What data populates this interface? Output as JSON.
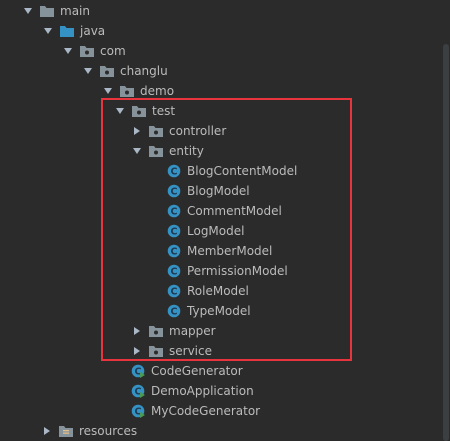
{
  "tree": {
    "nodes": [
      {
        "label": "main",
        "kind": "folder",
        "state": "expanded"
      },
      {
        "label": "java",
        "kind": "folder-source",
        "state": "expanded"
      },
      {
        "label": "com",
        "kind": "package",
        "state": "expanded"
      },
      {
        "label": "changlu",
        "kind": "package",
        "state": "expanded"
      },
      {
        "label": "demo",
        "kind": "package",
        "state": "expanded"
      },
      {
        "label": "test",
        "kind": "package",
        "state": "expanded"
      },
      {
        "label": "controller",
        "kind": "package",
        "state": "collapsed"
      },
      {
        "label": "entity",
        "kind": "package",
        "state": "expanded"
      },
      {
        "label": "BlogContentModel",
        "kind": "class"
      },
      {
        "label": "BlogModel",
        "kind": "class"
      },
      {
        "label": "CommentModel",
        "kind": "class"
      },
      {
        "label": "LogModel",
        "kind": "class"
      },
      {
        "label": "MemberModel",
        "kind": "class"
      },
      {
        "label": "PermissionModel",
        "kind": "class"
      },
      {
        "label": "RoleModel",
        "kind": "class"
      },
      {
        "label": "TypeModel",
        "kind": "class"
      },
      {
        "label": "mapper",
        "kind": "package",
        "state": "collapsed"
      },
      {
        "label": "service",
        "kind": "package",
        "state": "collapsed"
      },
      {
        "label": "CodeGenerator",
        "kind": "class-runnable"
      },
      {
        "label": "DemoApplication",
        "kind": "class-runnable"
      },
      {
        "label": "MyCodeGenerator",
        "kind": "class-runnable"
      },
      {
        "label": "resources",
        "kind": "folder-resources",
        "state": "collapsed"
      }
    ]
  },
  "colors": {
    "background": "#2b2b2b",
    "text": "#bbbbbb",
    "highlight": "#e8343c",
    "folder": "#87939a",
    "source_folder": "#3592c4",
    "class_icon": "#3592c4",
    "run_marker": "#499c54"
  },
  "icons": {
    "expanded": "chevron-down-icon",
    "collapsed": "chevron-right-icon",
    "folder": "folder-icon",
    "package": "package-icon",
    "class": "class-icon"
  }
}
